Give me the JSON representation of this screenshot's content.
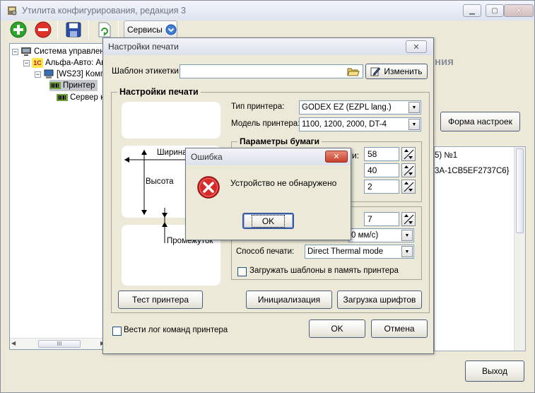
{
  "main_window": {
    "title": "Утилита конфигурирования, редакция 3",
    "toolbar": {
      "services_label": "Сервисы"
    },
    "tree": [
      {
        "label": "Система управлен",
        "level": 0,
        "expander": "−"
      },
      {
        "label": "Альфа-Авто: Ав",
        "level": 1,
        "expander": "−"
      },
      {
        "label": "[WS23] Комп",
        "level": 2,
        "expander": "−"
      },
      {
        "label": "Принтер",
        "level": 3,
        "expander": ""
      },
      {
        "label": "Сервер к",
        "level": 3,
        "expander": ""
      }
    ],
    "right_heading_fragment": "ния",
    "form_settings_button": "Форма настроек",
    "list_fragments": [
      "5) №1",
      "3A-1CB5EF2737C6}"
    ],
    "exit_button": "Выход"
  },
  "print_dialog": {
    "title": "Настройки печати",
    "template_label": "Шаблон этикетки:",
    "template_value": "",
    "change_button": "Изменить",
    "group_title": "Настройки печати",
    "printer_type_label": "Тип принтера:",
    "printer_type_value": "GODEX EZ (EZPL lang.)",
    "printer_model_label": "Модель принтера:",
    "printer_model_value": "1100, 1200, 2000, DT-4",
    "paper_group_title": "Параметры бумаги",
    "paper_label_fragments": [
      "и:",
      "",
      ""
    ],
    "paper_values": [
      "58",
      "40",
      "2"
    ],
    "diagram_labels": {
      "width": "Ширина",
      "height": "Высота",
      "gap": "Промежуток"
    },
    "speed_value": "7",
    "speed_combo_fragment": "0 мм/с)",
    "print_method_label": "Способ печати:",
    "print_method_value": "Direct Thermal mode",
    "load_templates_label": "Загружать шаблоны в память принтера",
    "test_button": "Тест принтера",
    "init_button": "Инициализация",
    "fonts_button": "Загрузка шрифтов",
    "log_label": "Вести лог команд принтера",
    "ok_button": "OK",
    "cancel_button": "Отмена"
  },
  "error_dialog": {
    "title": "Ошибка",
    "message": "Устройство не обнаружено",
    "ok_button": "OK"
  },
  "colors": {
    "accent": "#2a6cc8",
    "error_red": "#d82a2a",
    "titlebar": "#dde3ef"
  }
}
